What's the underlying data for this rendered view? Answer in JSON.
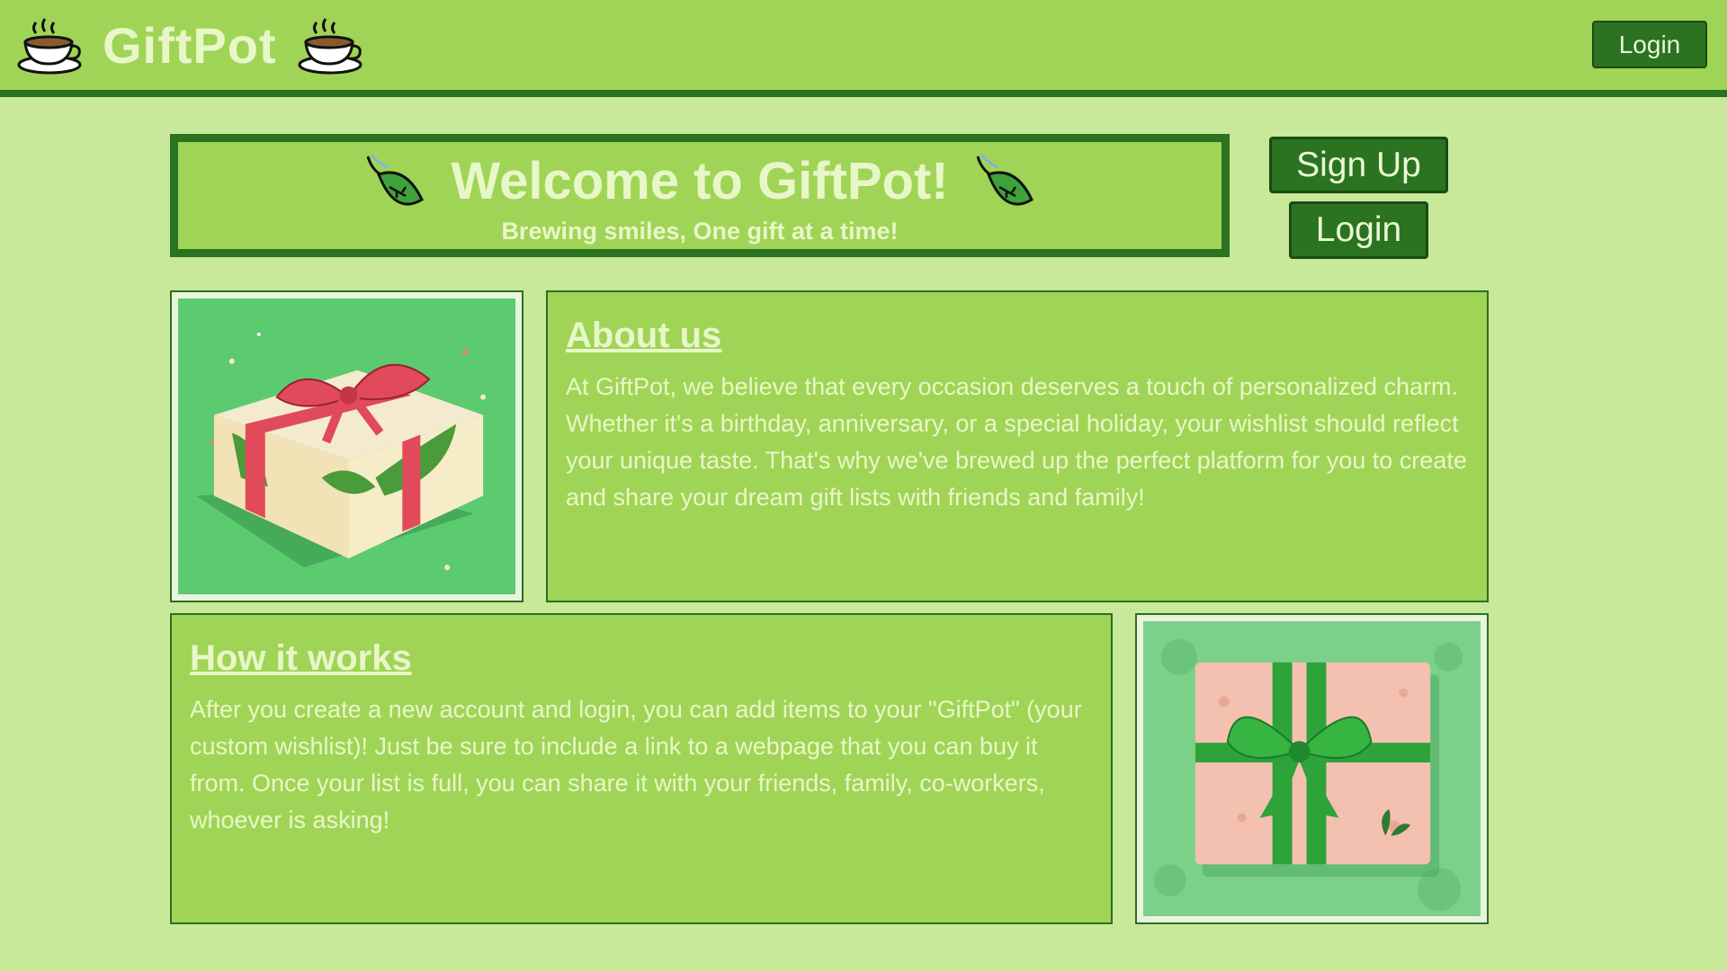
{
  "header": {
    "brand": "GiftPot",
    "login_label": "Login"
  },
  "welcome": {
    "title": "Welcome to GiftPot!",
    "subtitle": "Brewing smiles, One gift at a time!"
  },
  "actions": {
    "signup_label": "Sign Up",
    "login_label": "Login"
  },
  "about": {
    "heading": "About us",
    "body": "At GiftPot, we believe that every occasion deserves a touch of personalized charm. Whether it's a birthday, anniversary, or a special holiday, your wishlist should reflect your unique taste. That's why we've brewed up the perfect platform for you to create and share your dream gift lists with friends and family!"
  },
  "how": {
    "heading": "How it works",
    "body": "After you create a new account and login, you can add items to your \"GiftPot\" (your custom wishlist)! Just be sure to include a link to a webpage that you can buy it from. Once your list is full, you can share it with your friends, family, co-workers, whoever is asking!"
  },
  "colors": {
    "header_bg": "#a0d456",
    "page_bg": "#c8e89a",
    "button_bg": "#2b7320",
    "text_light": "#e8f7c8"
  },
  "icons": [
    "coffee-cup-icon",
    "tea-leaf-icon"
  ]
}
